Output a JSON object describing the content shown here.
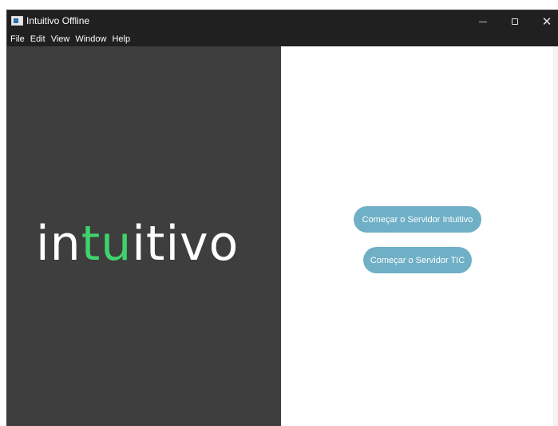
{
  "window": {
    "title": "Intuitivo Offline",
    "controls": {
      "minimize": "—",
      "maximize": "☐",
      "close": "✕"
    }
  },
  "menubar": {
    "items": [
      "File",
      "Edit",
      "View",
      "Window",
      "Help"
    ]
  },
  "logo": {
    "prefix": "in",
    "accent": "tu",
    "suffix": "itivo",
    "colors": {
      "text": "#ffffff",
      "accent": "#3fd36b",
      "panel_bg": "#3e3e3e"
    }
  },
  "actions": {
    "start_intuitivo": "Começar o Servidor Intuitivo",
    "start_tic": "Começar o Servidor TIC",
    "button_color": "#6fb0c6"
  },
  "icons": {
    "app": "app-window-icon",
    "minimize": "minimize-icon",
    "maximize": "maximize-icon",
    "close": "close-icon"
  }
}
